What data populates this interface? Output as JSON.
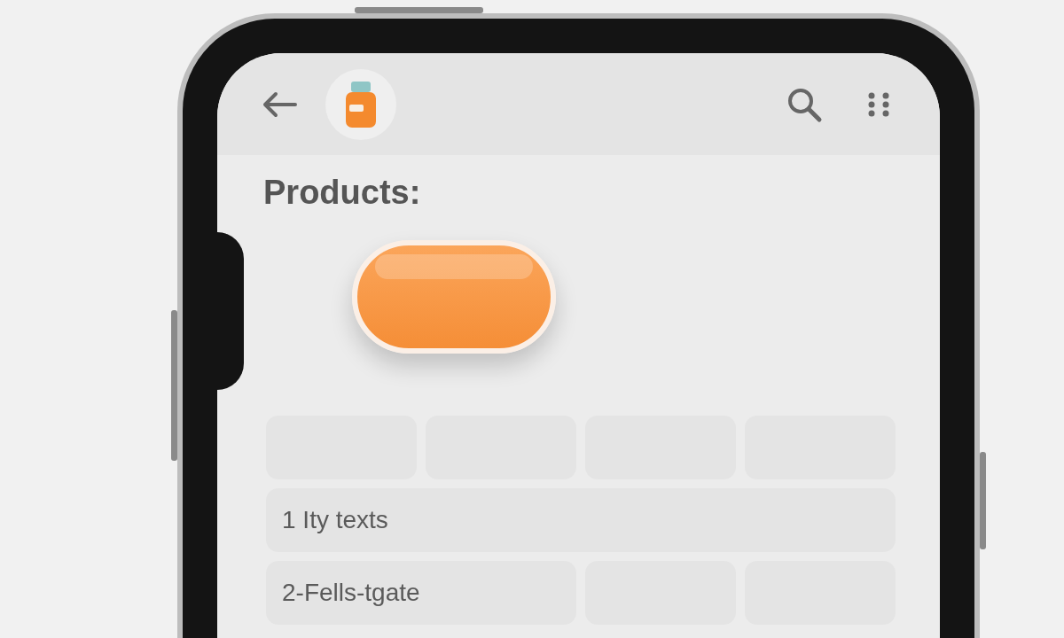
{
  "title": "Products:",
  "rows": [
    {
      "cells": [
        {
          "kind": "blank"
        },
        {
          "kind": "blank"
        },
        {
          "kind": "blank"
        },
        {
          "kind": "blank"
        }
      ]
    },
    {
      "cells": [
        {
          "kind": "full",
          "text": "1 Ity texts"
        }
      ]
    },
    {
      "cells": [
        {
          "kind": "half",
          "text": "2-Fells-tgate"
        },
        {
          "kind": "blank"
        },
        {
          "kind": "blank"
        }
      ]
    }
  ]
}
